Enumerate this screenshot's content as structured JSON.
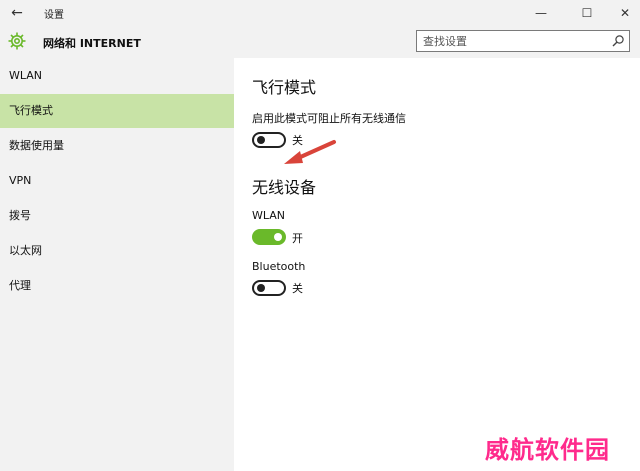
{
  "window": {
    "title": "设置",
    "back_icon": "←",
    "minimize_icon": "—",
    "maximize_icon": "☐",
    "close_icon": "✕"
  },
  "header": {
    "title": "网络和 INTERNET",
    "search_placeholder": "查找设置",
    "accent": "#6ab92a"
  },
  "sidebar": {
    "items": [
      {
        "label": "WLAN"
      },
      {
        "label": "飞行模式"
      },
      {
        "label": "数据使用量"
      },
      {
        "label": "VPN"
      },
      {
        "label": "拨号"
      },
      {
        "label": "以太网"
      },
      {
        "label": "代理"
      }
    ],
    "selected_color": "#c8e3a6"
  },
  "airplane": {
    "heading": "飞行模式",
    "description": "启用此模式可阻止所有无线通信",
    "state_label": "关"
  },
  "wireless": {
    "heading": "无线设备",
    "wlan_label": "WLAN",
    "wlan_state": "开",
    "bluetooth_label": "Bluetooth",
    "bluetooth_state": "关"
  },
  "annotation": {
    "arrow_color": "#d9443a"
  },
  "watermark": "威航软件园"
}
